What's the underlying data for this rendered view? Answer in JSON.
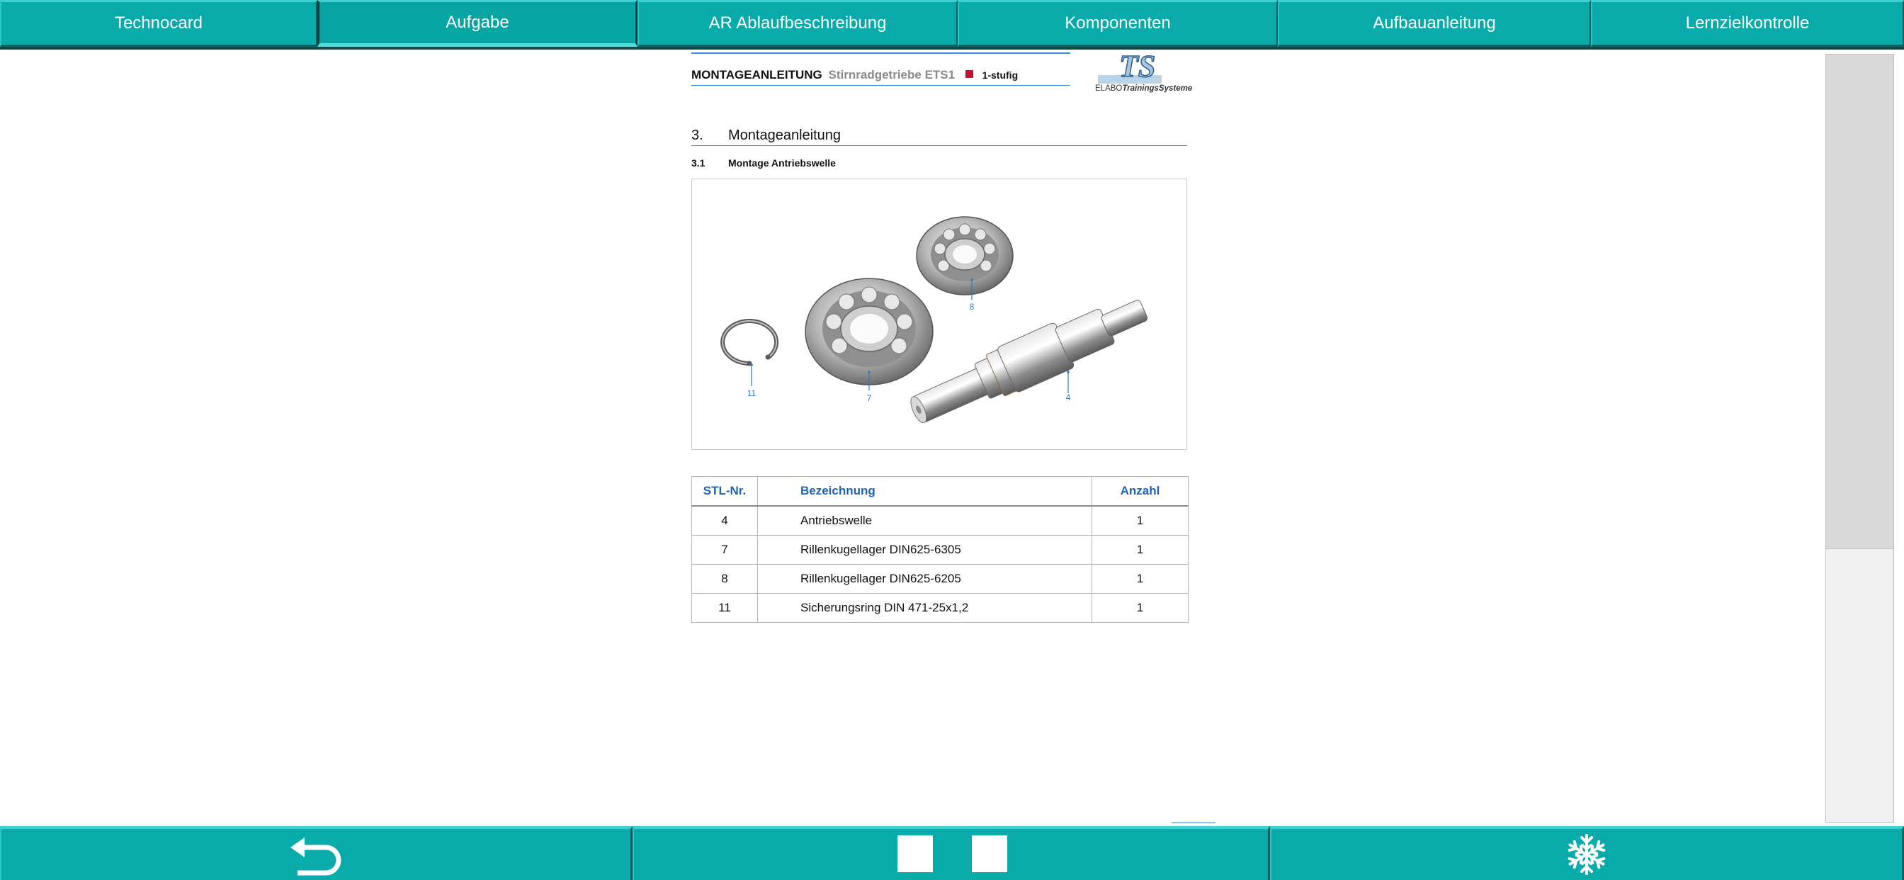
{
  "tabs": [
    {
      "label": "Technocard",
      "active": false
    },
    {
      "label": "Aufgabe",
      "active": true
    },
    {
      "label": "AR Ablaufbeschreibung",
      "active": false
    },
    {
      "label": "Komponenten",
      "active": false
    },
    {
      "label": "Aufbauanleitung",
      "active": false
    },
    {
      "label": "Lernzielkontrolle",
      "active": false
    }
  ],
  "document": {
    "header": {
      "title": "MONTAGEANLEITUNG",
      "subtitle": "Stirnradgetriebe ETS1",
      "variant": "1-stufig",
      "logo_mark": "TS",
      "logo_text_a": "ELABO",
      "logo_text_b": "TrainingsSysteme"
    },
    "section": {
      "number": "3.",
      "title": "Montageanleitung"
    },
    "subsection": {
      "number": "3.1",
      "title": "Montage Antriebswelle"
    },
    "figure_callouts": [
      "8",
      "11",
      "7",
      "4"
    ],
    "table": {
      "headers": [
        "STL-Nr.",
        "Bezeichnung",
        "Anzahl"
      ],
      "rows": [
        [
          "4",
          "Antriebswelle",
          "1"
        ],
        [
          "7",
          "Rillenkugellager DIN625-6305",
          "1"
        ],
        [
          "8",
          "Rillenkugellager DIN625-6205",
          "1"
        ],
        [
          "11",
          "Sicherungsring DIN 471-25x1,2",
          "1"
        ]
      ]
    }
  },
  "bottom_bar": {
    "back_icon": "back-arrow-icon",
    "center_icon": "pause-icon",
    "right_icon": "snowflake-icon"
  },
  "colors": {
    "teal": "#08aaaa",
    "dark_teal": "#0a4c4c",
    "accent_blue": "#1a63b5",
    "rule_blue": "#3a8fd1",
    "marker_red": "#c8102e"
  }
}
